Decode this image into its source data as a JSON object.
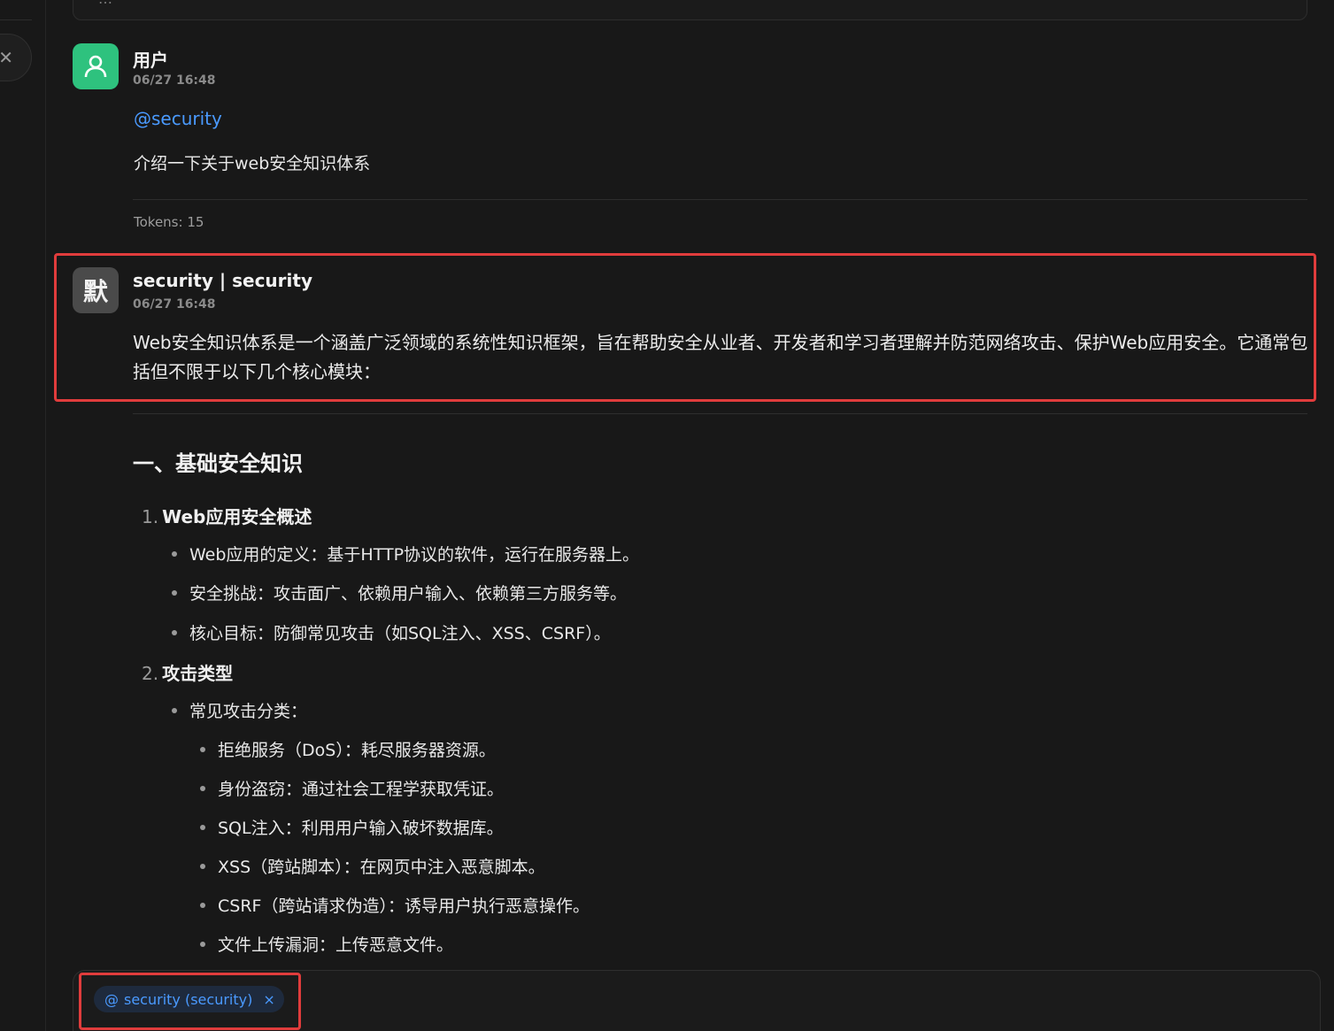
{
  "top_card": {
    "text": "…"
  },
  "left_rail": {
    "close_icon": "close-icon"
  },
  "messages": {
    "user": {
      "name": "用户",
      "time": "06/27 16:48",
      "mention": "@security",
      "text": "介绍一下关于web安全知识体系",
      "tokens": "Tokens: 15",
      "avatar_icon": "user-icon",
      "avatar_color": "#2ec27e"
    },
    "bot": {
      "avatar_char": "默",
      "name": "security | security",
      "time": "06/27 16:48",
      "intro": "Web安全知识体系是一个涵盖广泛领域的系统性知识框架，旨在帮助安全从业者、开发者和学习者理解并防范网络攻击、保护Web应用安全。它通常包括但不限于以下几个核心模块：",
      "section_title": "一、基础安全知识",
      "sections": [
        {
          "num": "1.",
          "title": "Web应用安全概述",
          "items": [
            "Web应用的定义：基于HTTP协议的软件，运行在服务器上。",
            "安全挑战：攻击面广、依赖用户输入、依赖第三方服务等。",
            "核心目标：防御常见攻击（如SQL注入、XSS、CSRF）。"
          ]
        },
        {
          "num": "2.",
          "title": "攻击类型",
          "items": [
            "常见攻击分类："
          ],
          "subitems": [
            "拒绝服务（DoS）：耗尽服务器资源。",
            "身份盗窃：通过社会工程学获取凭证。",
            "SQL注入：利用用户输入破坏数据库。",
            "XSS（跨站脚本）：在网页中注入恶意脚本。",
            "CSRF（跨站请求伪造）：诱导用户执行恶意操作。",
            "文件上传漏洞：上传恶意文件。"
          ]
        }
      ]
    }
  },
  "input": {
    "chip_at": "@",
    "chip_label": "security (security)",
    "chip_close": "×"
  },
  "colors": {
    "background": "#181818",
    "accent": "#4a9aff",
    "highlight": "#e03c3c"
  }
}
